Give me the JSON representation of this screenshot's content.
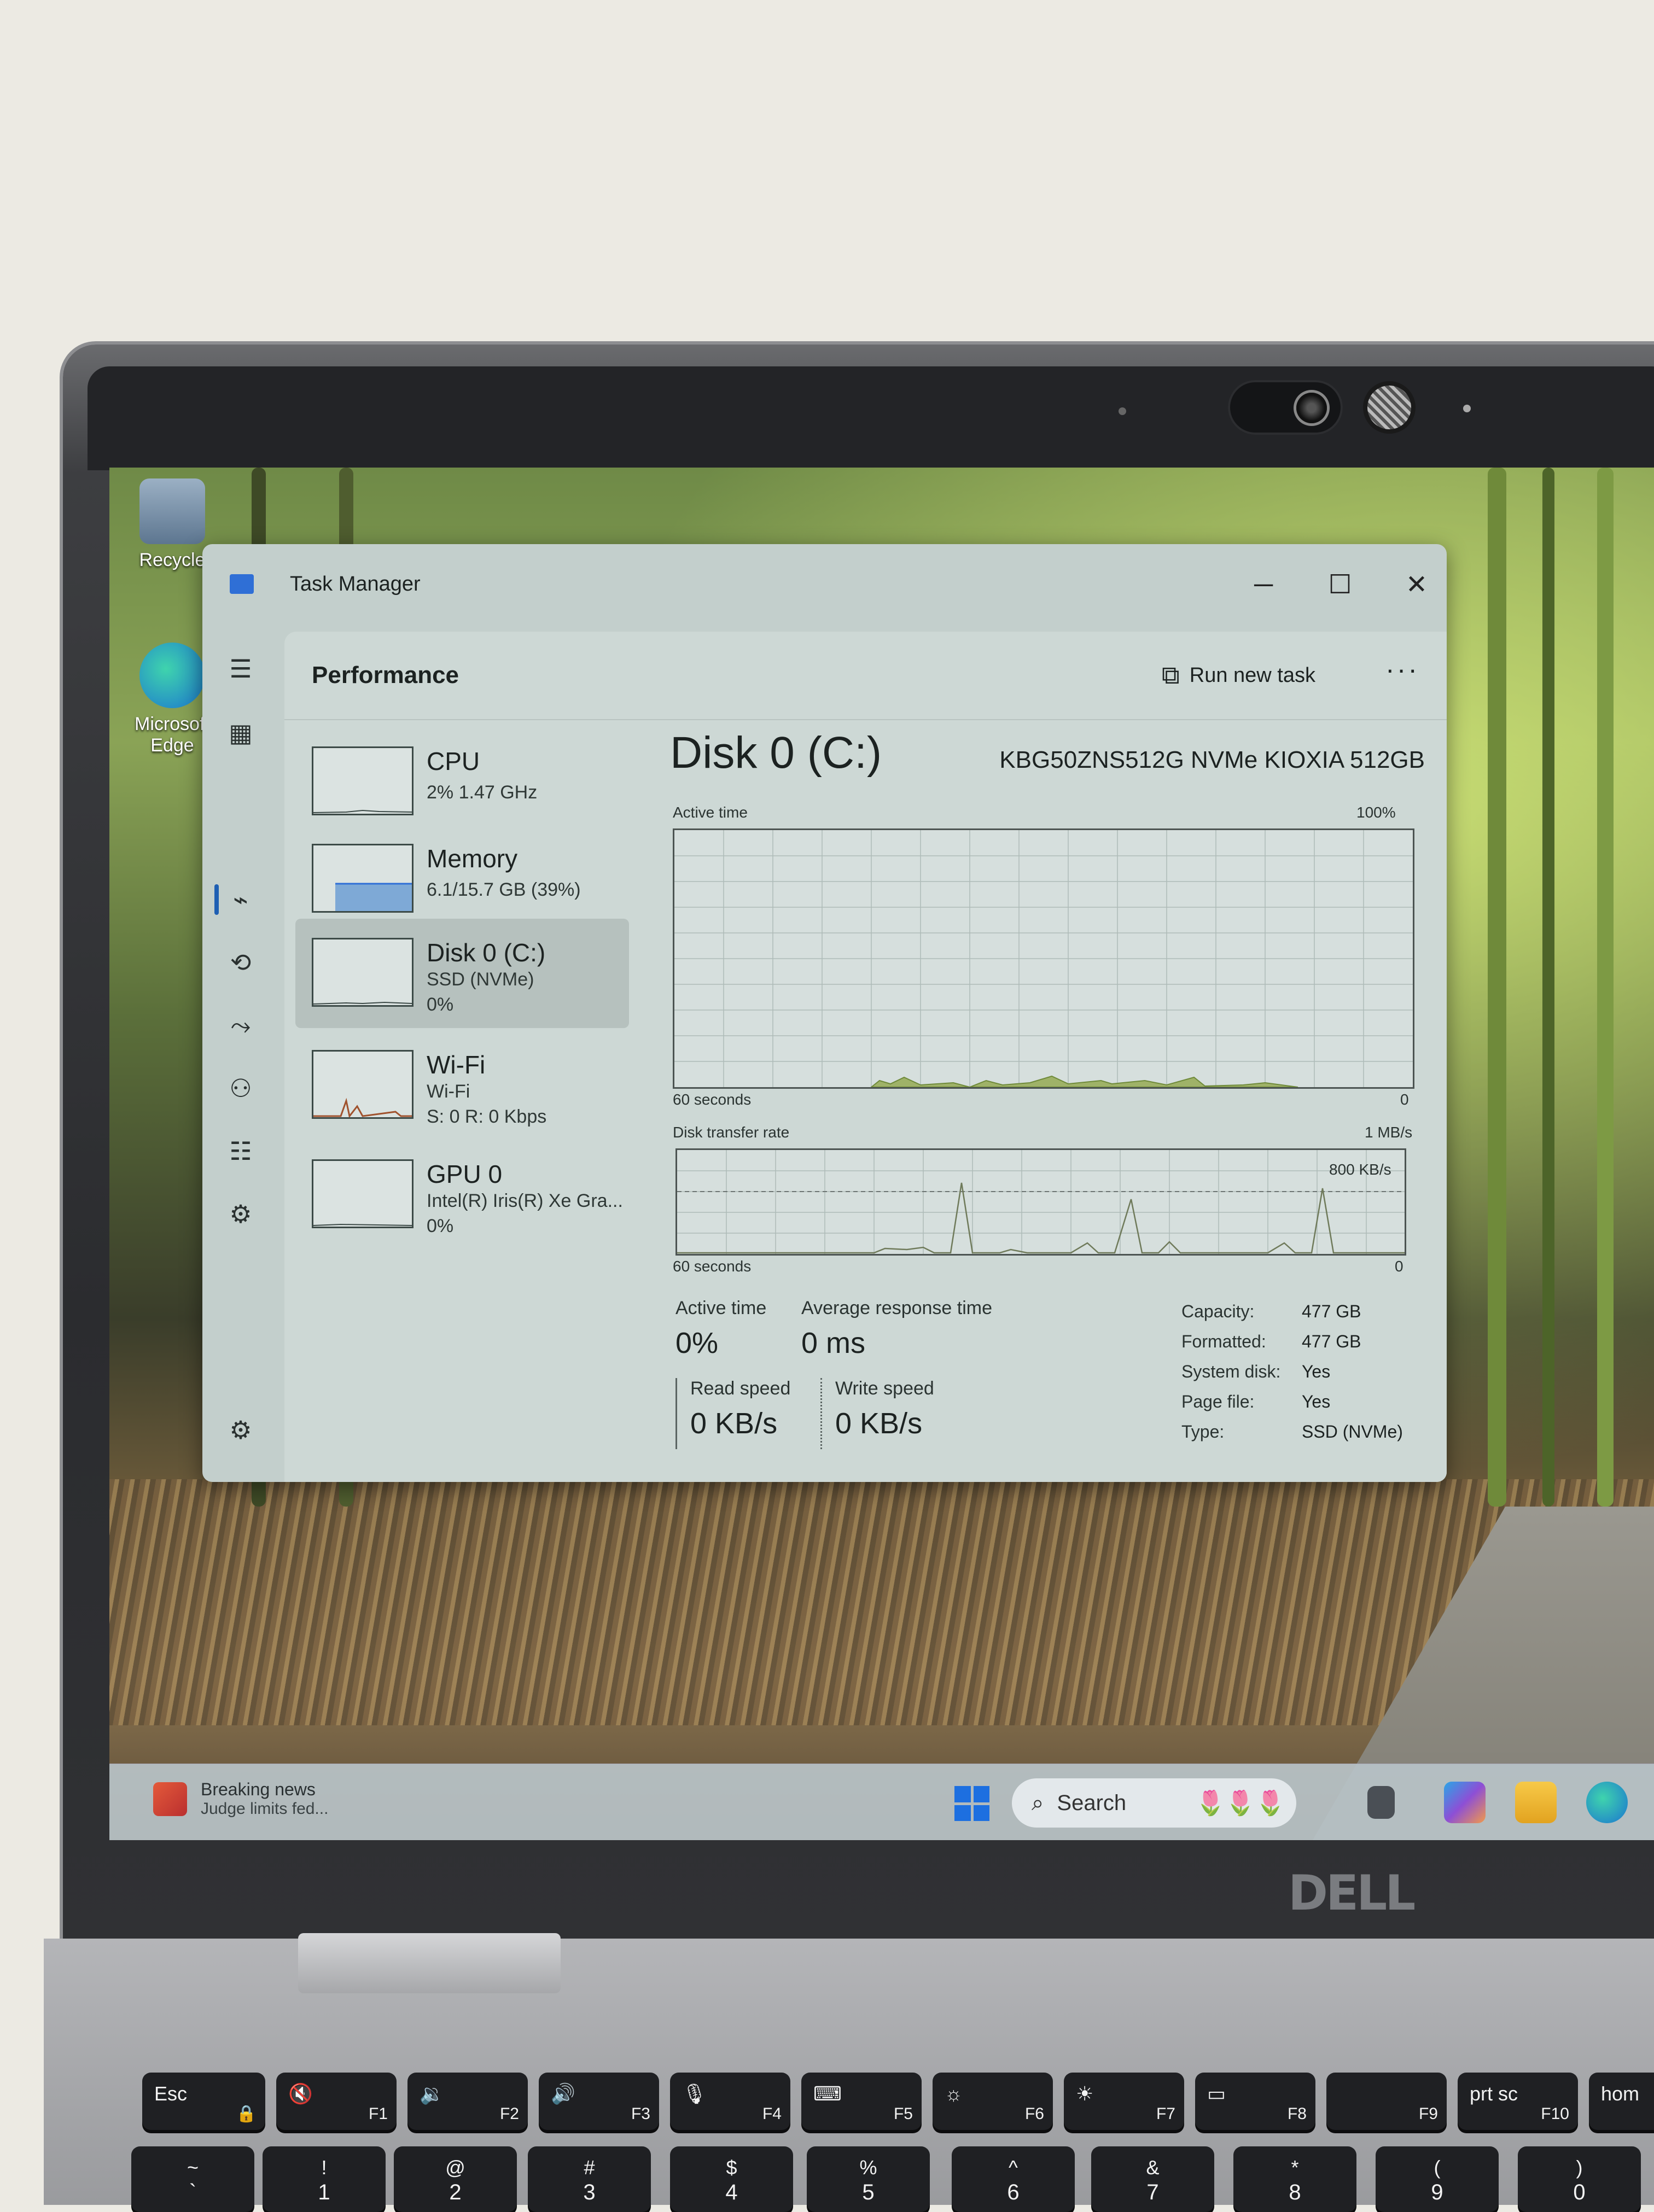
{
  "window": {
    "title": "Task Manager",
    "controls": {
      "minimize": "─",
      "maximize": "☐",
      "close": "✕"
    }
  },
  "nav_rail": [
    {
      "icon": "hamburger-menu-icon",
      "glyph": "☰"
    },
    {
      "icon": "processes-icon",
      "glyph": "▦"
    },
    {
      "icon": "performance-icon",
      "glyph": "⌁",
      "active": true
    },
    {
      "icon": "app-history-icon",
      "glyph": "⟲"
    },
    {
      "icon": "startup-apps-icon",
      "glyph": "⤳"
    },
    {
      "icon": "users-icon",
      "glyph": "⚇"
    },
    {
      "icon": "details-icon",
      "glyph": "☷"
    },
    {
      "icon": "services-icon",
      "glyph": "⚙"
    }
  ],
  "header": {
    "title": "Performance",
    "run_new_task": "Run new task",
    "more": "···"
  },
  "resources": [
    {
      "name": "CPU",
      "line1": "2% 1.47 GHz",
      "line2": ""
    },
    {
      "name": "Memory",
      "line1": "6.1/15.7 GB (39%)",
      "line2": ""
    },
    {
      "name": "Disk 0 (C:)",
      "line1": "SSD (NVMe)",
      "line2": "0%",
      "selected": true
    },
    {
      "name": "Wi-Fi",
      "line1": "Wi-Fi",
      "line2": "S: 0 R: 0 Kbps"
    },
    {
      "name": "GPU 0",
      "line1": "Intel(R) Iris(R) Xe Gra...",
      "line2": "0%"
    }
  ],
  "detail": {
    "title": "Disk 0 (C:)",
    "model": "KBG50ZNS512G NVMe KIOXIA 512GB",
    "active_graph": {
      "label": "Active time",
      "max": "100%",
      "time": "60 seconds",
      "min": "0"
    },
    "transfer_graph": {
      "label": "Disk transfer rate",
      "max": "1 MB/s",
      "marker": "800 KB/s",
      "time": "60 seconds",
      "min": "0"
    },
    "stats": {
      "active_time_label": "Active time",
      "active_time_value": "0%",
      "avg_response_label": "Average response time",
      "avg_response_value": "0 ms",
      "read_label": "Read speed",
      "read_value": "0 KB/s",
      "write_label": "Write speed",
      "write_value": "0 KB/s"
    },
    "properties": [
      {
        "label": "Capacity:",
        "value": "477 GB"
      },
      {
        "label": "Formatted:",
        "value": "477 GB"
      },
      {
        "label": "System disk:",
        "value": "Yes"
      },
      {
        "label": "Page file:",
        "value": "Yes"
      },
      {
        "label": "Type:",
        "value": "SSD (NVMe)"
      }
    ]
  },
  "desktop_icons": [
    {
      "label": "Recycle",
      "icon": "recycle-bin-icon"
    },
    {
      "label": "Microsoft Edge",
      "icon": "edge-icon"
    }
  ],
  "taskbar": {
    "news_title": "Breaking news",
    "news_sub": "Judge limits fed...",
    "search_placeholder": "Search"
  },
  "brand": "DELL",
  "keyboard": {
    "function_row": [
      {
        "main": "Esc",
        "fn": "🔒"
      },
      {
        "main": "🔇",
        "fn": "F1"
      },
      {
        "main": "🔉",
        "fn": "F2"
      },
      {
        "main": "🔊",
        "fn": "F3"
      },
      {
        "main": "🎙",
        "fn": "F4"
      },
      {
        "main": "⌨",
        "fn": "F5"
      },
      {
        "main": "☼",
        "fn": "F6"
      },
      {
        "main": "☀",
        "fn": "F7"
      },
      {
        "main": "▭",
        "fn": "F8"
      },
      {
        "main": "",
        "fn": "F9"
      },
      {
        "main": "prt sc",
        "fn": "F10"
      },
      {
        "main": "hom",
        "fn": ""
      }
    ],
    "number_row": [
      {
        "top": "~",
        "bot": "`"
      },
      {
        "top": "!",
        "bot": "1"
      },
      {
        "top": "@",
        "bot": "2"
      },
      {
        "top": "#",
        "bot": "3"
      },
      {
        "top": "$",
        "bot": "4"
      },
      {
        "top": "%",
        "bot": "5"
      },
      {
        "top": "^",
        "bot": "6"
      },
      {
        "top": "&",
        "bot": "7"
      },
      {
        "top": "*",
        "bot": "8"
      },
      {
        "top": "(",
        "bot": "9"
      },
      {
        "top": ")",
        "bot": "0"
      }
    ]
  },
  "colors": {
    "window_bg": "#c3cfcc",
    "accent": "#1e5fb3",
    "graph_fill": "#8fa45a"
  }
}
